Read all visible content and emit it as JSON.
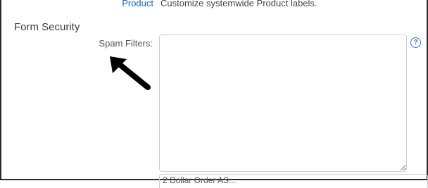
{
  "top_row": {
    "link_label": "Product",
    "description": "Customize systemwide Product labels."
  },
  "section": {
    "title": "Form Security"
  },
  "spam_filters": {
    "label": "Spam Filters:",
    "value": "",
    "help_glyph": "?"
  },
  "next_field": {
    "peek_text": "2 Dollar Order AS..."
  },
  "icons": {
    "help": "help-circle-icon",
    "annotation": "pointer-arrow-icon"
  },
  "colors": {
    "link": "#1f5fbf",
    "help": "#2f73c9",
    "frame": "#2b2b2b"
  }
}
